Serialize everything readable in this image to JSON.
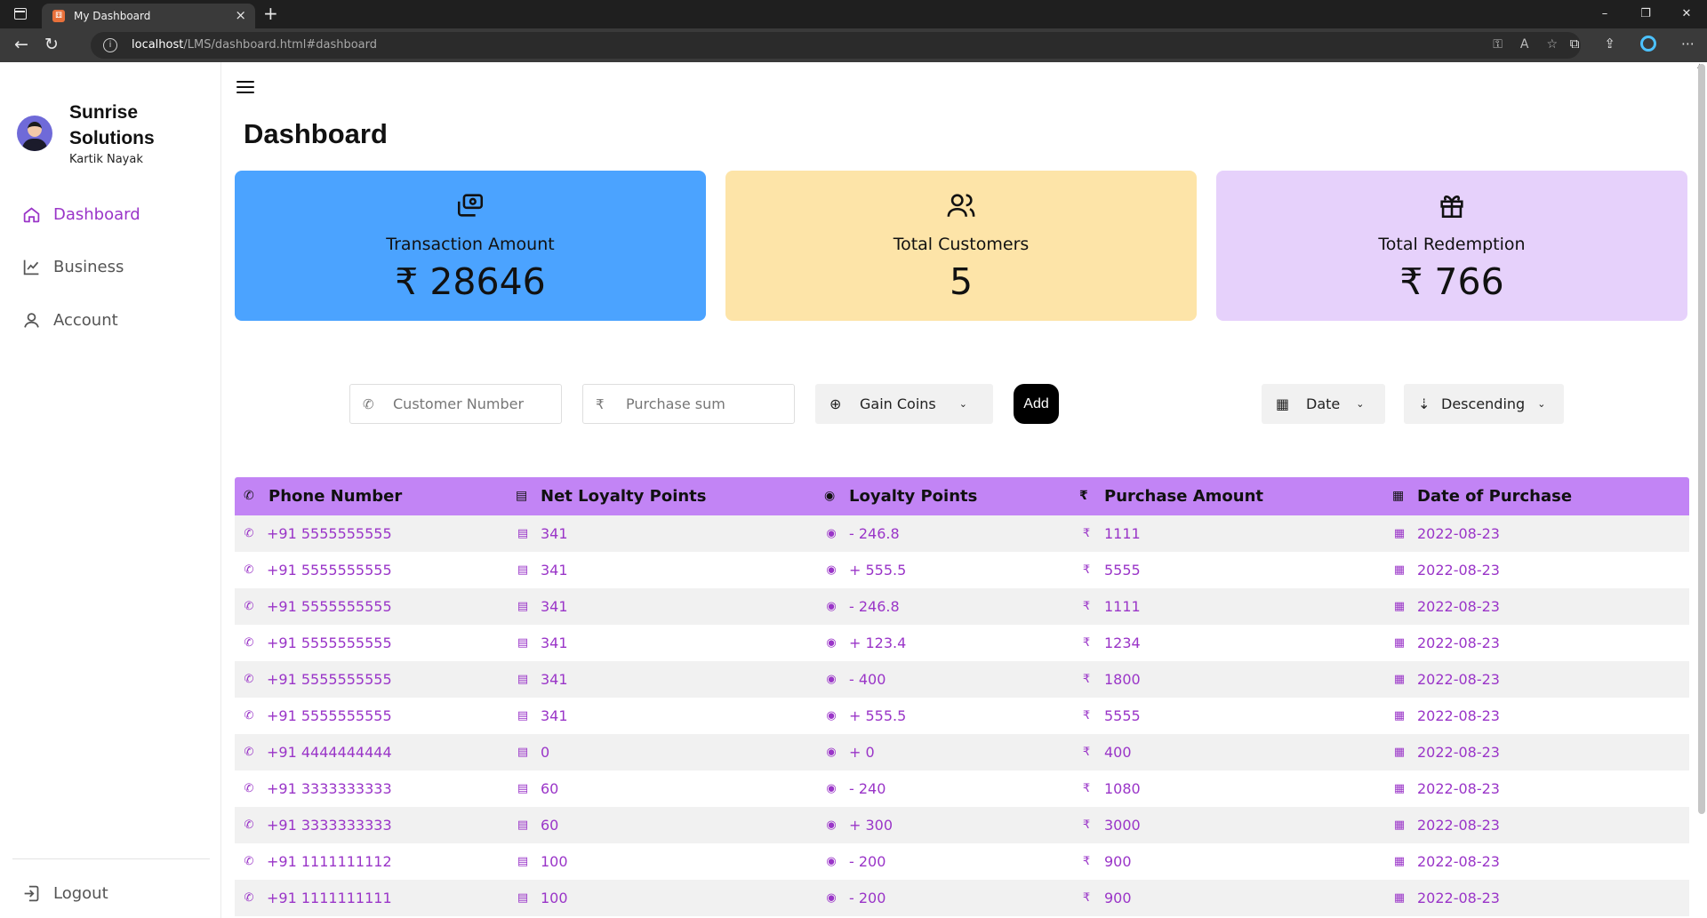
{
  "browser": {
    "tab_title": "My Dashboard",
    "tab_favicon": "⚅",
    "url_host": "localhost",
    "url_path": "/LMS/dashboard.html#dashboard",
    "controls": {
      "minimize": "–",
      "restore": "❐",
      "close": "✕"
    }
  },
  "sidebar": {
    "brand": "Sunrise Solutions",
    "user": "Kartik Nayak",
    "items": [
      {
        "label": "Dashboard",
        "icon": "home-icon",
        "active": true
      },
      {
        "label": "Business",
        "icon": "chart-line-icon",
        "active": false
      },
      {
        "label": "Account",
        "icon": "user-icon",
        "active": false
      }
    ],
    "logout": "Logout"
  },
  "main": {
    "title": "Dashboard",
    "cards": [
      {
        "label": "Transaction Amount",
        "value": "₹ 28646",
        "icon": "money-transfer-icon",
        "color": "#4ba3ff"
      },
      {
        "label": "Total Customers",
        "value": "5",
        "icon": "users-icon",
        "color": "#fde4a8"
      },
      {
        "label": "Total Redemption",
        "value": "₹ 766",
        "icon": "gift-icon",
        "color": "#e6d1fb"
      }
    ],
    "controls": {
      "customer_placeholder": "Customer Number",
      "purchase_placeholder": "Purchase sum",
      "gain_select": "Gain Coins",
      "add": "Add",
      "sort_field": "Date",
      "sort_order": "Descending"
    },
    "table": {
      "columns": [
        "Phone Number",
        "Net Loyalty Points",
        "Loyalty Points",
        "Purchase Amount",
        "Date of Purchase"
      ],
      "rows": [
        [
          "+91 5555555555",
          "341",
          "- 246.8",
          "1111",
          "2022-08-23"
        ],
        [
          "+91 5555555555",
          "341",
          "+ 555.5",
          "5555",
          "2022-08-23"
        ],
        [
          "+91 5555555555",
          "341",
          "- 246.8",
          "1111",
          "2022-08-23"
        ],
        [
          "+91 5555555555",
          "341",
          "+ 123.4",
          "1234",
          "2022-08-23"
        ],
        [
          "+91 5555555555",
          "341",
          "- 400",
          "1800",
          "2022-08-23"
        ],
        [
          "+91 5555555555",
          "341",
          "+ 555.5",
          "5555",
          "2022-08-23"
        ],
        [
          "+91 4444444444",
          "0",
          "+ 0",
          "400",
          "2022-08-23"
        ],
        [
          "+91 3333333333",
          "60",
          "- 240",
          "1080",
          "2022-08-23"
        ],
        [
          "+91 3333333333",
          "60",
          "+ 300",
          "3000",
          "2022-08-23"
        ],
        [
          "+91 1111111112",
          "100",
          "- 200",
          "900",
          "2022-08-23"
        ],
        [
          "+91 1111111111",
          "100",
          "- 200",
          "900",
          "2022-08-23"
        ]
      ]
    }
  }
}
